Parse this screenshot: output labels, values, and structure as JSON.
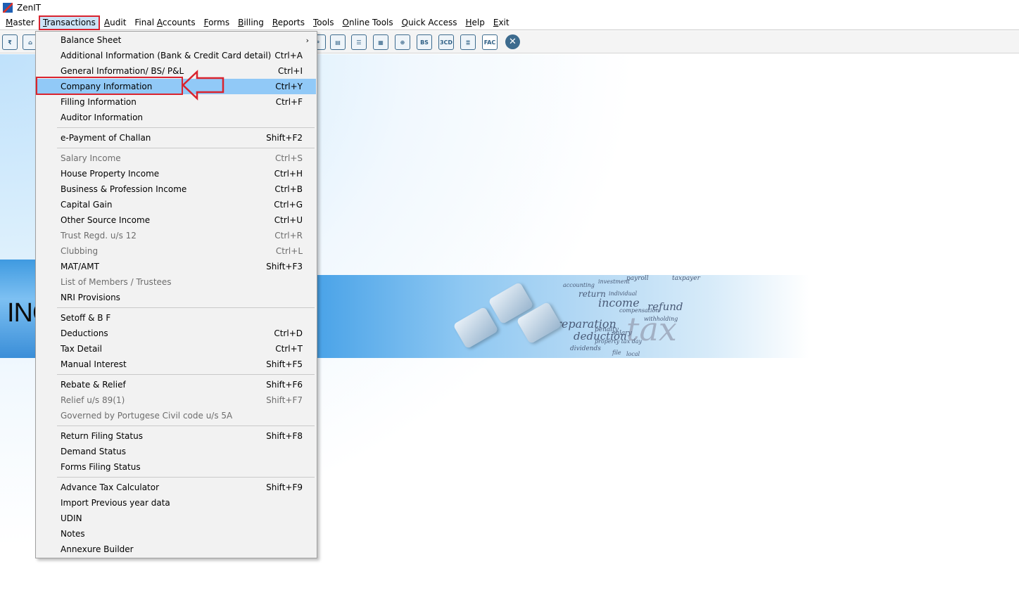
{
  "app": {
    "title": "ZenIT"
  },
  "menubar": [
    {
      "label": "Master",
      "ul": "M",
      "rest": "aster"
    },
    {
      "label": "Transactions",
      "ul": "T",
      "rest": "ransactions",
      "active": true
    },
    {
      "label": "Audit",
      "ul": "A",
      "rest": "udit"
    },
    {
      "label": "Final Accounts",
      "ul": "",
      "rest": "Final Accounts"
    },
    {
      "label": "Forms",
      "ul": "F",
      "rest": "orms"
    },
    {
      "label": "Billing",
      "ul": "B",
      "rest": "illing"
    },
    {
      "label": "Reports",
      "ul": "R",
      "rest": "eports"
    },
    {
      "label": "Tools",
      "ul": "T",
      "rest": "ools"
    },
    {
      "label": "Online Tools",
      "ul": "O",
      "rest": "nline Tools"
    },
    {
      "label": "Quick Access",
      "ul": "Q",
      "rest": "uick Access"
    },
    {
      "label": "Help",
      "ul": "H",
      "rest": "elp"
    },
    {
      "label": "Exit",
      "ul": "E",
      "rest": "xit"
    }
  ],
  "toolbar": {
    "icons": [
      "rupee-icon",
      "home-icon",
      "search-icon",
      "report-icon",
      "user-doc-icon",
      "calendar-icon",
      "folder-add-icon",
      "bs-icon",
      "3cd-icon",
      "ledger-icon",
      "fac-icon",
      "close-icon"
    ],
    "bs_label": "BS",
    "cd_label": "3CD",
    "fac_label": "FAC"
  },
  "banner": {
    "inc_text": "INC",
    "words": [
      "preparation",
      "deduction",
      "income",
      "refund",
      "tax",
      "return",
      "penalty",
      "salary",
      "dividends",
      "payroll",
      "taxpayer",
      "investment",
      "accounting",
      "individual",
      "compensation",
      "withholding",
      "property tax day",
      "local",
      "file"
    ]
  },
  "dropdown": {
    "items": [
      {
        "label": "Balance Sheet",
        "shortcut": "",
        "submenu": true
      },
      {
        "label": "Additional Information (Bank & Credit Card detail)",
        "shortcut": "Ctrl+A"
      },
      {
        "label": "General Information/ BS/ P&L",
        "shortcut": "Ctrl+I"
      },
      {
        "label": "Company Information",
        "shortcut": "Ctrl+Y",
        "highlighted": true
      },
      {
        "label": "Filling Information",
        "shortcut": "Ctrl+F"
      },
      {
        "label": "Auditor Information",
        "shortcut": ""
      },
      {
        "sep": true
      },
      {
        "label": "e-Payment of Challan",
        "shortcut": "Shift+F2"
      },
      {
        "sep": true
      },
      {
        "label": "Salary Income",
        "shortcut": "Ctrl+S",
        "disabled": true
      },
      {
        "label": "House Property Income",
        "shortcut": "Ctrl+H"
      },
      {
        "label": "Business & Profession Income",
        "shortcut": "Ctrl+B"
      },
      {
        "label": "Capital Gain",
        "shortcut": "Ctrl+G"
      },
      {
        "label": "Other Source Income",
        "shortcut": "Ctrl+U"
      },
      {
        "label": "Trust Regd. u/s 12",
        "shortcut": "Ctrl+R",
        "disabled": true
      },
      {
        "label": "Clubbing",
        "shortcut": "Ctrl+L",
        "disabled": true
      },
      {
        "label": "MAT/AMT",
        "shortcut": "Shift+F3"
      },
      {
        "label": "List of Members / Trustees",
        "shortcut": "",
        "disabled": true
      },
      {
        "label": "NRI Provisions",
        "shortcut": ""
      },
      {
        "sep": true
      },
      {
        "label": "Setoff & B F",
        "shortcut": ""
      },
      {
        "label": "Deductions",
        "shortcut": "Ctrl+D"
      },
      {
        "label": "Tax Detail",
        "shortcut": "Ctrl+T"
      },
      {
        "label": "Manual Interest",
        "shortcut": "Shift+F5"
      },
      {
        "sep": true
      },
      {
        "label": "Rebate & Relief",
        "shortcut": "Shift+F6"
      },
      {
        "label": "Relief u/s 89(1)",
        "shortcut": "Shift+F7",
        "disabled": true
      },
      {
        "label": "Governed by Portugese Civil code u/s 5A",
        "shortcut": "",
        "disabled": true
      },
      {
        "sep": true
      },
      {
        "label": "Return Filing Status",
        "shortcut": "Shift+F8"
      },
      {
        "label": "Demand Status",
        "shortcut": ""
      },
      {
        "label": "Forms Filing Status",
        "shortcut": ""
      },
      {
        "sep": true
      },
      {
        "label": "Advance Tax Calculator",
        "shortcut": "Shift+F9"
      },
      {
        "label": "Import Previous year data",
        "shortcut": ""
      },
      {
        "label": "UDIN",
        "shortcut": ""
      },
      {
        "label": "Notes",
        "shortcut": ""
      },
      {
        "label": "Annexure Builder",
        "shortcut": ""
      }
    ]
  },
  "colors": {
    "highlight": "#91c9f7",
    "annotation_red": "#d9232e"
  }
}
